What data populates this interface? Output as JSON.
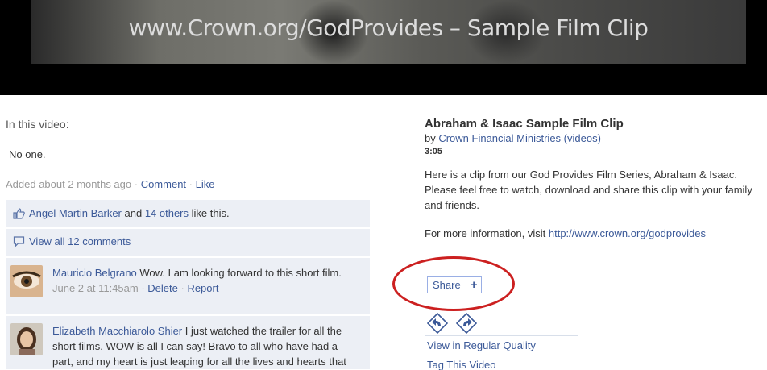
{
  "video": {
    "overlay_text": "www.Crown.org/GodProvides – Sample Film Clip"
  },
  "tags": {
    "heading": "In this video:",
    "value": "No one."
  },
  "meta": {
    "added": "Added about 2 months ago",
    "separator": " · ",
    "comment_link": "Comment",
    "like_link": "Like"
  },
  "feedback": {
    "liker": "Angel Martin Barker",
    "and": " and ",
    "others": "14 others",
    "like_suffix": " like this.",
    "view_all": "View all 12 comments"
  },
  "comments": [
    {
      "author": "Mauricio Belgrano",
      "text": " Wow. I am looking forward to this short film.",
      "time": "June 2 at 11:45am",
      "delete": "Delete",
      "report": "Report"
    },
    {
      "author": "Elizabeth Macchiarolo Shier",
      "text": " I just watched the trailer for all the short films. WOW is all I can say! Bravo to all who have had a part, and my heart is just leaping for all the lives and hearts that will be changed because of this"
    }
  ],
  "clip": {
    "title": "Abraham & Isaac Sample Film Clip",
    "by_prefix": "by ",
    "owner": "Crown Financial Ministries",
    "videos_open": " (",
    "videos_link": "videos",
    "videos_close": ")",
    "duration": "3:05",
    "description": "Here is a clip from our God Provides Film Series, Abraham & Isaac. Please feel free to watch, download and share this clip with your family and friends.",
    "more_prefix": "For more information, visit ",
    "more_url": "http://www.crown.org/godprovides"
  },
  "share": {
    "label": "Share",
    "plus": "+"
  },
  "actions": [
    "View in Regular Quality",
    "Tag This Video"
  ],
  "colors": {
    "link": "#3b5998",
    "feedback_bg": "#eceff5",
    "annotation": "#cc2020"
  }
}
